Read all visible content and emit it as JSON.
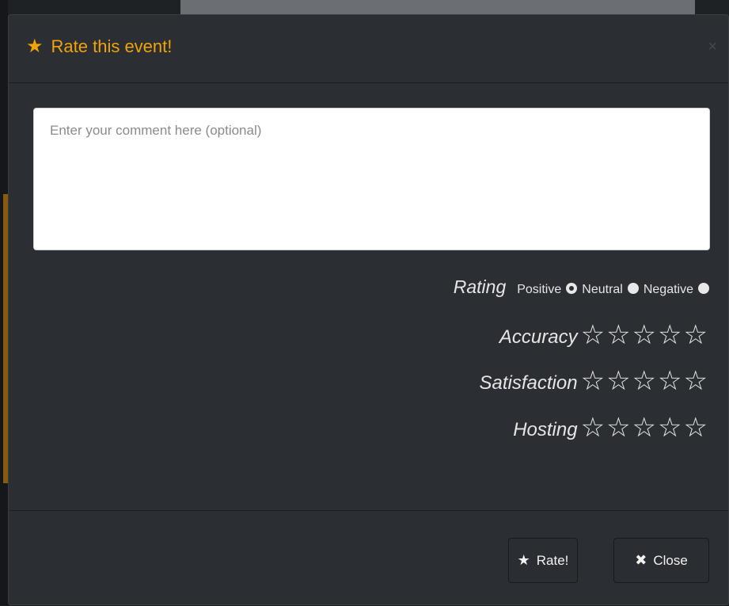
{
  "modal": {
    "title": "Rate this event!",
    "title_icon": "star-icon",
    "close_icon": "×"
  },
  "comment": {
    "value": "",
    "placeholder": "Enter your comment here (optional)"
  },
  "rating": {
    "label": "Rating",
    "options": [
      {
        "label": "Positive",
        "selected": true
      },
      {
        "label": "Neutral",
        "selected": false
      },
      {
        "label": "Negative",
        "selected": false
      }
    ]
  },
  "scores": [
    {
      "label": "Accuracy",
      "value": 0,
      "max": 5
    },
    {
      "label": "Satisfaction",
      "value": 0,
      "max": 5
    },
    {
      "label": "Hosting",
      "value": 0,
      "max": 5
    }
  ],
  "buttons": {
    "rate_label": "Rate!",
    "close_label": "Close"
  },
  "colors": {
    "accent": "#f0a30a",
    "modal_bg": "#2b2e32"
  }
}
